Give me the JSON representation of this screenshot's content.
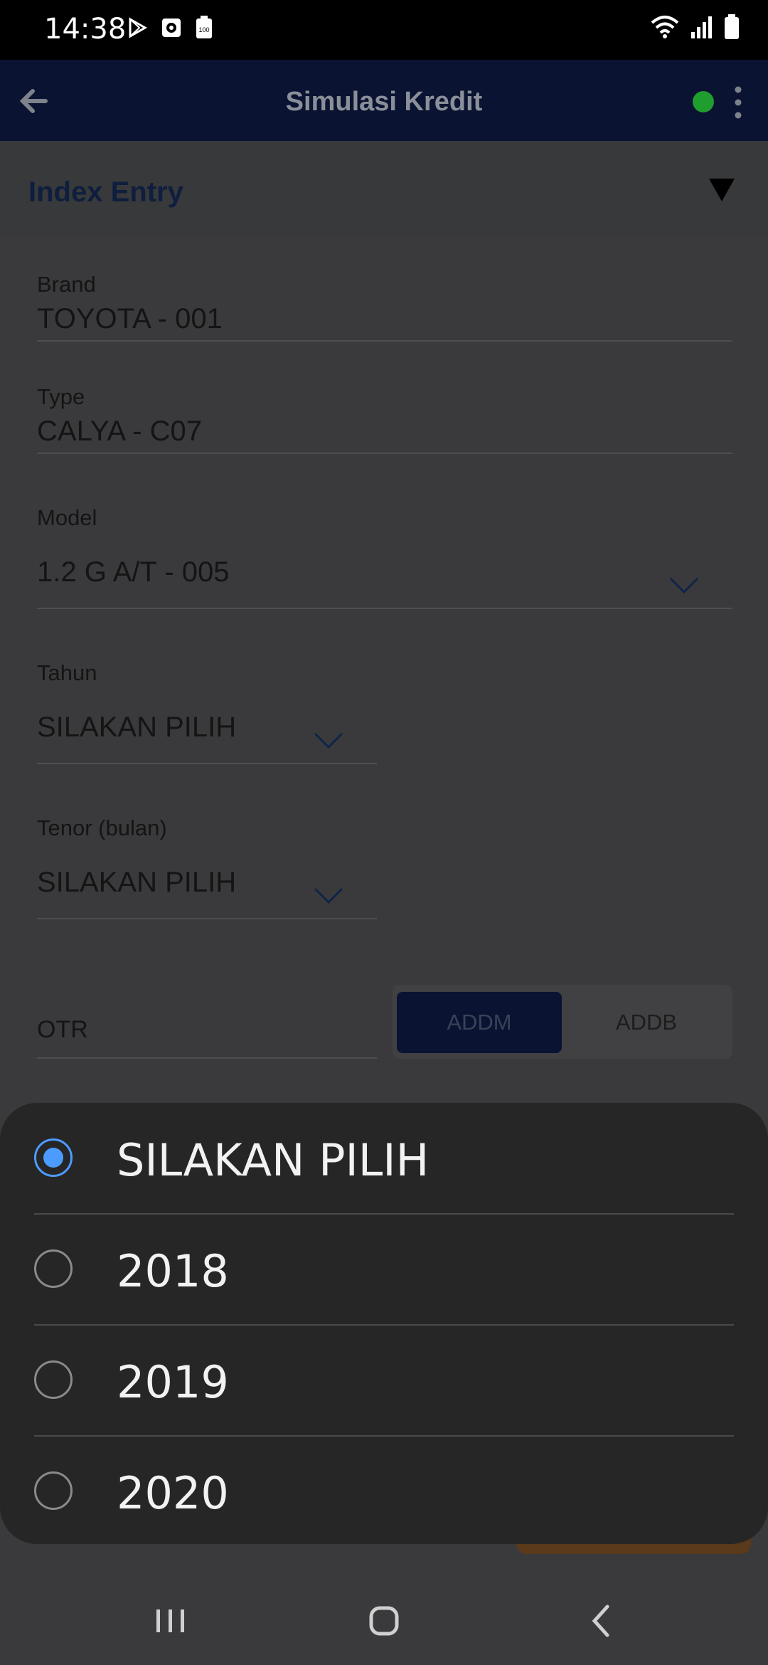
{
  "status_bar": {
    "time": "14:38",
    "icons_left": [
      "play-store-icon",
      "screen-record-icon",
      "battery-saver-icon"
    ],
    "icons_right": [
      "wifi-icon",
      "signal-icon",
      "battery-icon"
    ]
  },
  "app_bar": {
    "title": "Simulasi Kredit",
    "status_color": "#1f9d2f"
  },
  "section": {
    "title": "Index Entry"
  },
  "form": {
    "brand": {
      "label": "Brand",
      "value": "TOYOTA - 001"
    },
    "type": {
      "label": "Type",
      "value": "CALYA - C07"
    },
    "model": {
      "label": "Model",
      "value": "1.2 G A/T - 005"
    },
    "tahun": {
      "label": "Tahun",
      "value": "SILAKAN PILIH"
    },
    "tenor": {
      "label": "Tenor (bulan)",
      "value": "SILAKAN PILIH"
    },
    "otr": {
      "label": "OTR"
    },
    "toggle": {
      "options": [
        "ADDM",
        "ADDB"
      ],
      "selected": "ADDM"
    }
  },
  "dialog": {
    "options": [
      "SILAKAN PILIH",
      "2018",
      "2019",
      "2020"
    ],
    "selected_index": 0,
    "accent": "#4c9cff"
  },
  "colors": {
    "app_bar": "#0a1331",
    "scrim_bg": "#3a3a3c",
    "sheet_bg": "#262626"
  }
}
